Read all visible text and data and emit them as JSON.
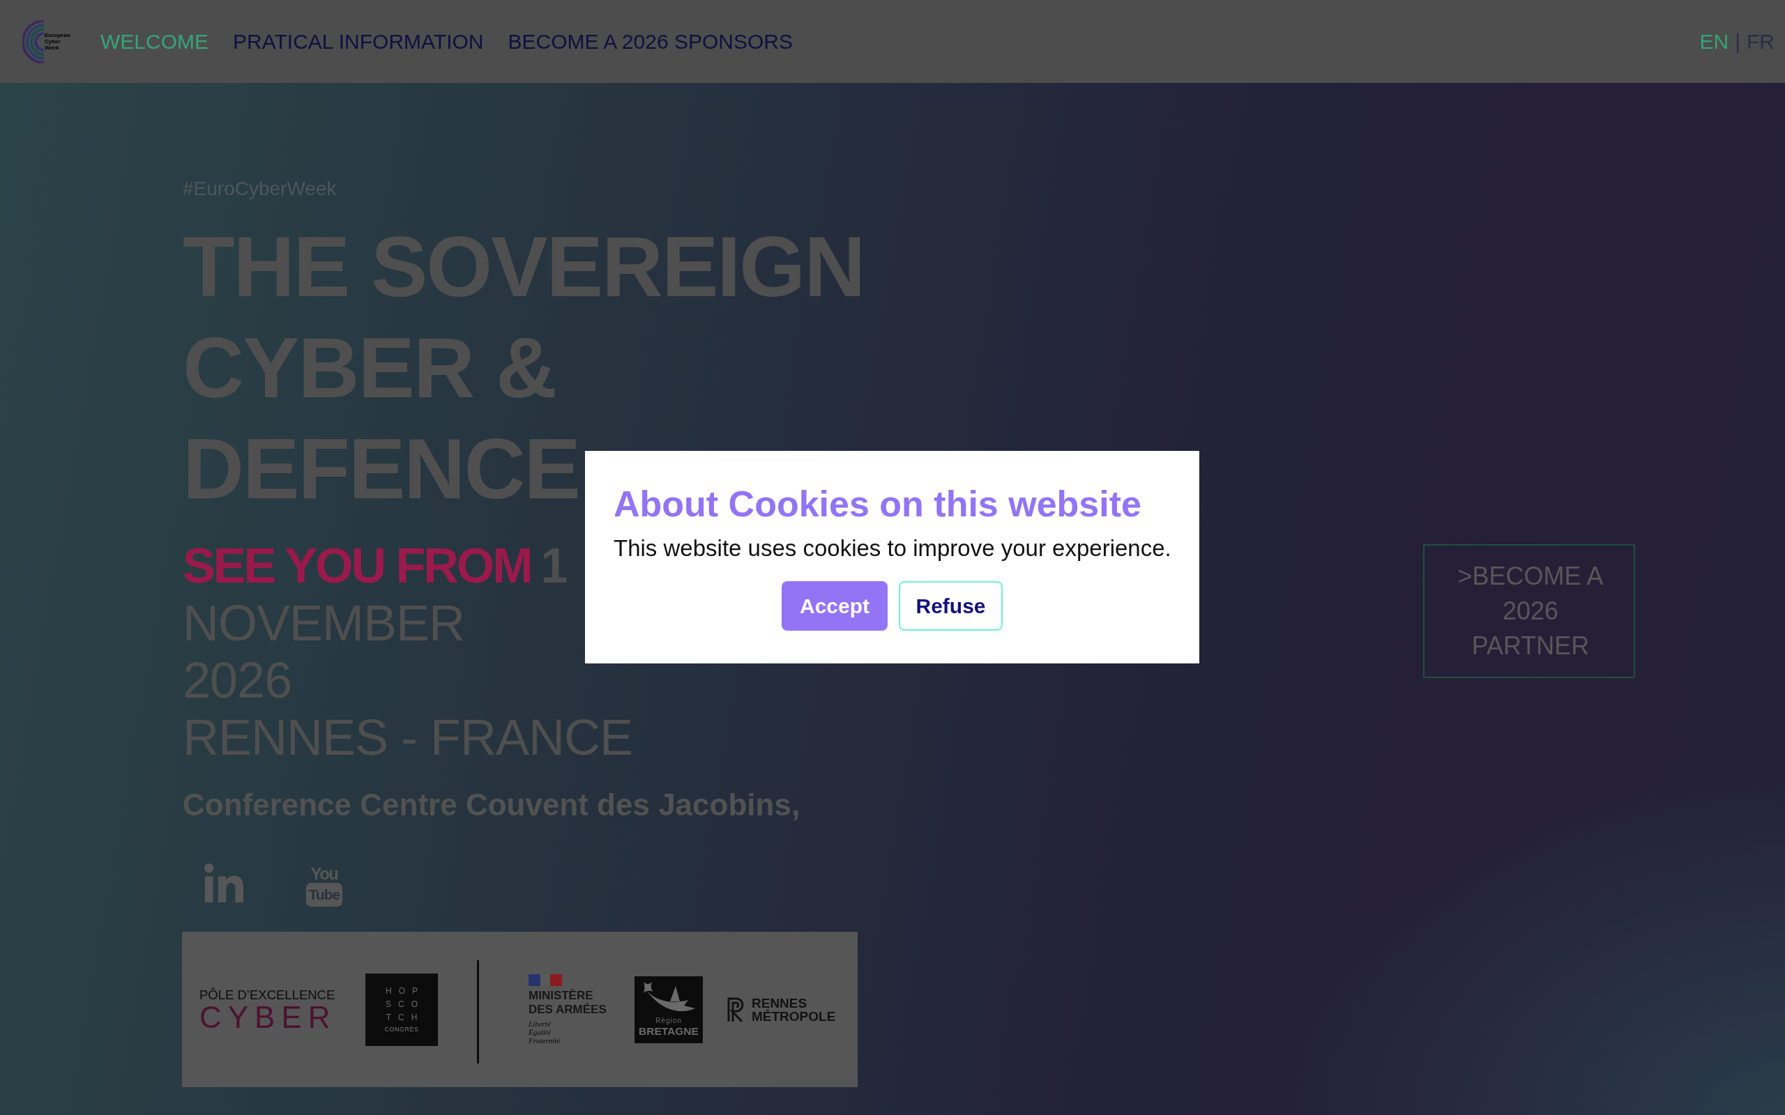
{
  "header": {
    "logo": {
      "text": "European Cyber Week"
    },
    "nav": [
      {
        "label": "WELCOME",
        "selected": true
      },
      {
        "label": "PRATICAL INFORMATION",
        "selected": false
      },
      {
        "label": "BECOME A 2026 SPONSORS",
        "selected": false
      }
    ],
    "languages": [
      {
        "label": "EN",
        "selected": true
      },
      {
        "label": "FR",
        "selected": false
      }
    ],
    "language_separator": "|"
  },
  "hero": {
    "hashtag": "#EuroCyberWeek",
    "title_lines": [
      "THE SOVEREIGN",
      "CYBER &",
      "DEFENCE"
    ],
    "date_lead": "SEE YOU FROM",
    "date_start": "1",
    "date_lines": [
      "NOVEMBER",
      "2026",
      "RENNES - FRANCE"
    ],
    "venue": "Conference Centre Couvent des Jacobins,",
    "social": [
      {
        "kind": "linkedin"
      },
      {
        "kind": "youtube",
        "lines": [
          "You",
          "Tube"
        ]
      }
    ],
    "cta": ">BECOME A 2026 PARTNER"
  },
  "logo_groups": [
    {
      "logos": [
        {
          "kind": "pole",
          "lines": [
            "PÔLE D’EXCELLENCE",
            "CYBER"
          ]
        },
        {
          "kind": "hopscotch",
          "lines": [
            "HOP",
            "SCO",
            "TCH"
          ],
          "caption": "CONGRÈS"
        }
      ]
    },
    {
      "logos": [
        {
          "kind": "ministry",
          "lines": [
            "MINISTÈRE",
            "DES ARMÉES"
          ],
          "motto": [
            "Liberté",
            "Égalité",
            "Fraternité"
          ]
        },
        {
          "kind": "region",
          "lines": [
            "Région",
            "BRETAGNE"
          ]
        },
        {
          "kind": "metropole",
          "lines": [
            "RENNES",
            "MÉTROPOLE"
          ]
        }
      ]
    }
  ],
  "cookie_dialog": {
    "title": "About Cookies on this website",
    "text": "This website uses cookies to improve your experience.",
    "buttons": [
      {
        "kind": "primary",
        "label": "Accept"
      },
      {
        "kind": "secondary",
        "label": "Refuse"
      }
    ]
  }
}
